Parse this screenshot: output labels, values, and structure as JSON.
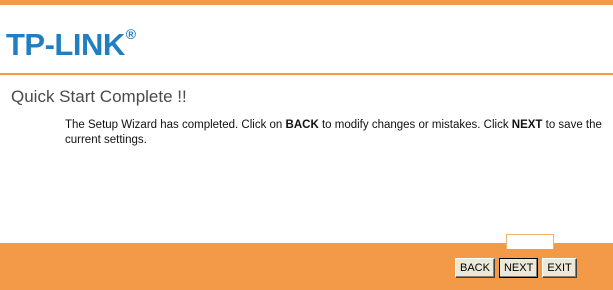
{
  "brand": {
    "logo_text": "TP-LINK",
    "logo_mark": "®"
  },
  "page": {
    "title": "Quick Start Complete !!"
  },
  "message": {
    "part1": "The Setup Wizard has completed. Click on ",
    "back_word": "BACK",
    "part2": " to modify changes or mistakes. Click ",
    "next_word": "NEXT",
    "part3": " to save the current settings."
  },
  "buttons": {
    "back": "BACK",
    "next": "NEXT",
    "exit": "EXIT"
  },
  "colors": {
    "accent_orange": "#f29a47",
    "logo_blue": "#1f7fc2",
    "title_gray": "#4a4a4a"
  }
}
